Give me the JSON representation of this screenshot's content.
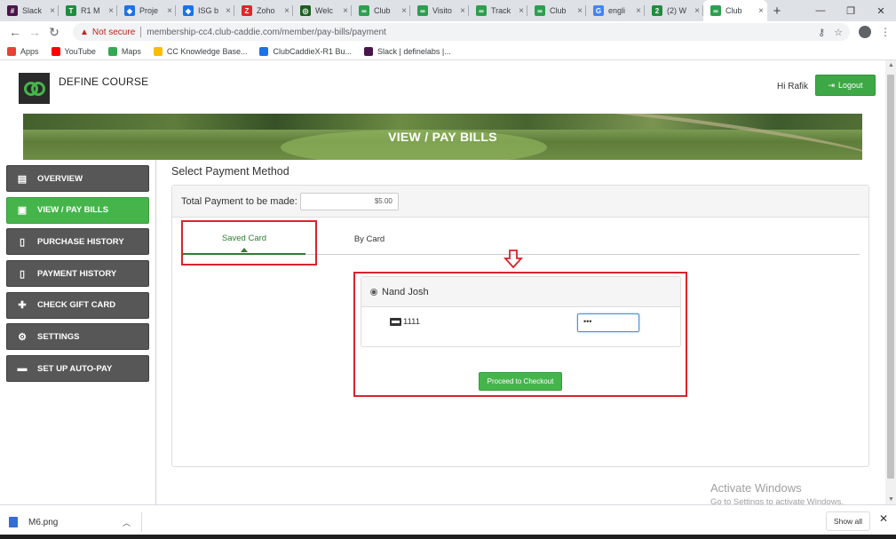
{
  "browser": {
    "tabs": [
      {
        "label": "Slack",
        "fav": "#4a154b",
        "glyph": "#"
      },
      {
        "label": "R1 M",
        "fav": "#1e8e3e",
        "glyph": "T"
      },
      {
        "label": "Proje",
        "fav": "#1a73e8",
        "glyph": "◆"
      },
      {
        "label": "ISG b",
        "fav": "#1a73e8",
        "glyph": "◆"
      },
      {
        "label": "Zoho",
        "fav": "#e42527",
        "glyph": "Z"
      },
      {
        "label": "Welc",
        "fav": "#1b5e20",
        "glyph": "◎"
      },
      {
        "label": "Club",
        "fav": "#2e9e4f",
        "glyph": "∞"
      },
      {
        "label": "Visito",
        "fav": "#2e9e4f",
        "glyph": "∞"
      },
      {
        "label": "Track",
        "fav": "#2e9e4f",
        "glyph": "∞"
      },
      {
        "label": "Club",
        "fav": "#2e9e4f",
        "glyph": "∞"
      },
      {
        "label": "engli",
        "fav": "#4285f4",
        "glyph": "G"
      },
      {
        "label": "(2) W",
        "fav": "#1e8e3e",
        "glyph": "2"
      },
      {
        "label": "Club",
        "fav": "#2e9e4f",
        "glyph": "∞",
        "active": true
      }
    ],
    "not_secure": "Not secure",
    "url": "membership-cc4.club-caddie.com/member/pay-bills/payment",
    "bookmarks": [
      {
        "label": "Apps",
        "color": "#e94235"
      },
      {
        "label": "YouTube",
        "color": "#ff0000"
      },
      {
        "label": "Maps",
        "color": "#34a853"
      },
      {
        "label": "CC Knowledge Base...",
        "color": "#fbbc04"
      },
      {
        "label": "ClubCaddieX-R1 Bu...",
        "color": "#1a73e8"
      },
      {
        "label": "Slack | definelabs |...",
        "color": "#4a154b"
      }
    ]
  },
  "header": {
    "course_name": "DEFINE COURSE",
    "greeting": "Hi Rafik",
    "logout_label": "Logout"
  },
  "banner": {
    "title": "VIEW / PAY BILLS"
  },
  "sidebar": {
    "items": [
      {
        "label": "OVERVIEW",
        "icon": "id-card-icon",
        "glyph": "▤",
        "name": "sidebar-item-overview"
      },
      {
        "label": "VIEW / PAY BILLS",
        "icon": "wallet-icon",
        "glyph": "▣",
        "active": true,
        "name": "sidebar-item-view-pay-bills"
      },
      {
        "label": "PURCHASE HISTORY",
        "icon": "document-icon",
        "glyph": "▯",
        "name": "sidebar-item-purchase-history"
      },
      {
        "label": "PAYMENT HISTORY",
        "icon": "document-icon",
        "glyph": "▯",
        "name": "sidebar-item-payment-history"
      },
      {
        "label": "CHECK GIFT CARD",
        "icon": "gift-icon",
        "glyph": "✚",
        "name": "sidebar-item-check-gift-card"
      },
      {
        "label": "SETTINGS",
        "icon": "gear-icon",
        "glyph": "⚙",
        "name": "sidebar-item-settings"
      },
      {
        "label": "SET UP AUTO-PAY",
        "icon": "credit-card-icon",
        "glyph": "▬",
        "name": "sidebar-item-set-up-auto-pay"
      }
    ]
  },
  "payment": {
    "section_title": "Select Payment Method",
    "total_label": "Total Payment to be made:",
    "total_value": "$5.00",
    "tabs": {
      "saved": "Saved Card",
      "by_card": "By Card"
    },
    "card_holder": "Nand Josh",
    "card_last4": "1111",
    "cvv_value": "•••",
    "proceed_label": "Proceed to Checkout"
  },
  "watermark": {
    "line1": "Activate Windows",
    "line2": "Go to Settings to activate Windows."
  },
  "downloads": {
    "file_name": "M6.png",
    "show_all": "Show all"
  },
  "colors": {
    "accent_green": "#45b54b",
    "annotation_red": "#d9232d"
  }
}
